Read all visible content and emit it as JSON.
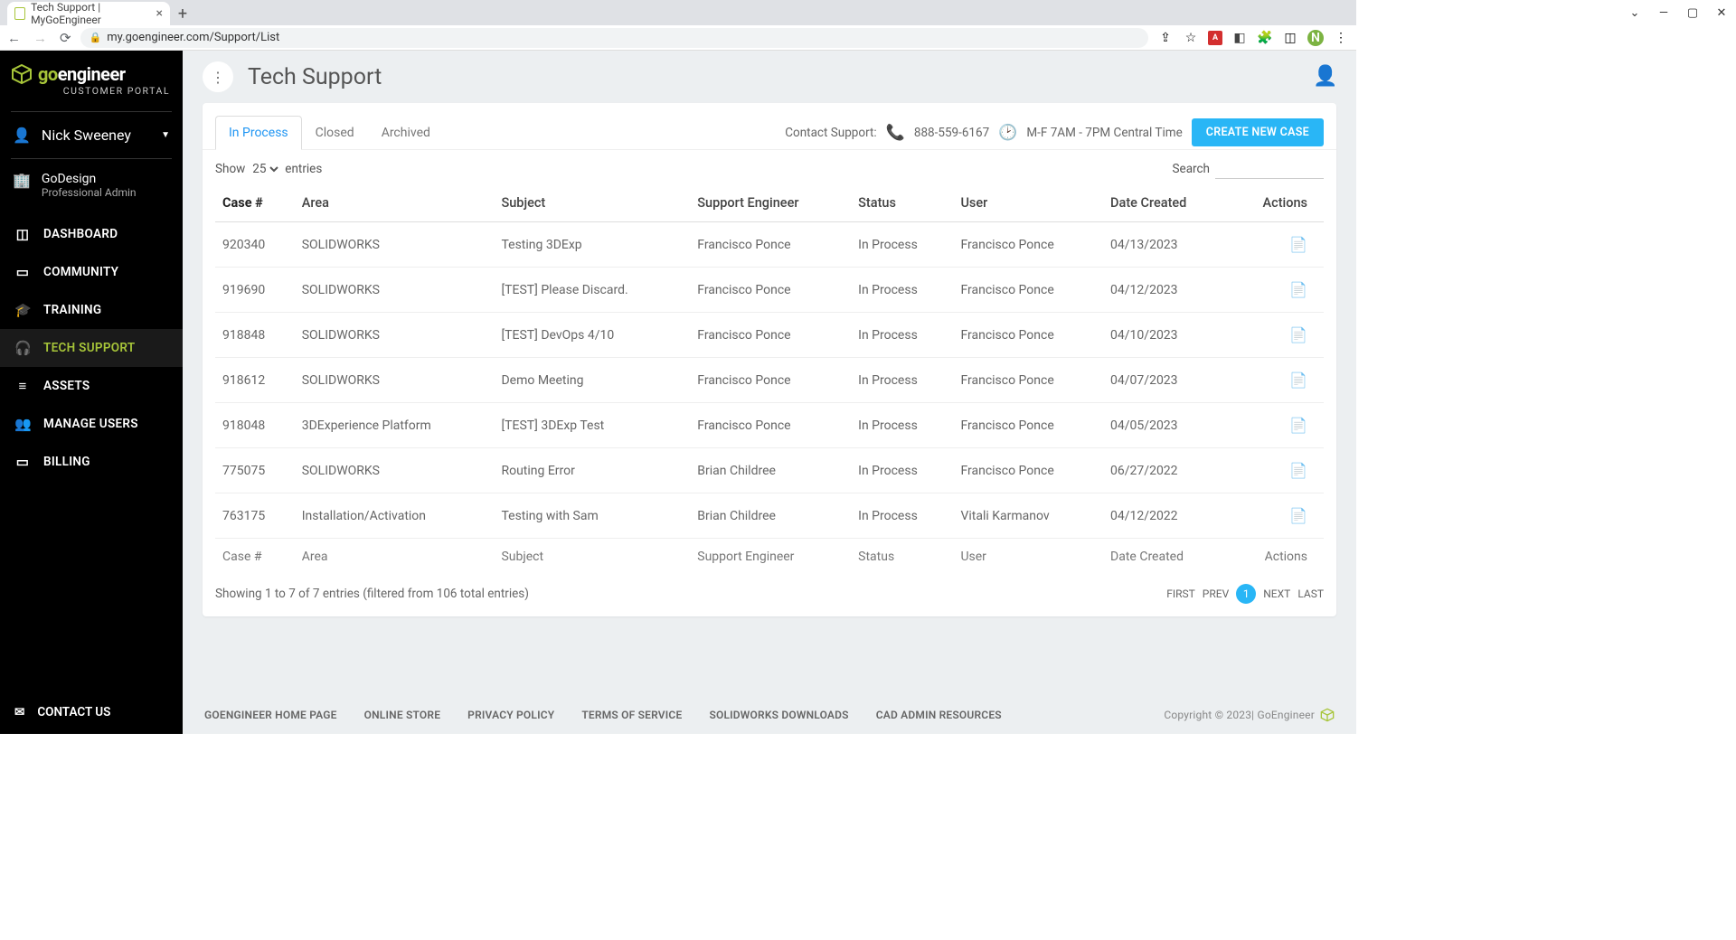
{
  "browser": {
    "tab_title": "Tech Support | MyGoEngineer",
    "url": "my.goengineer.com/Support/List",
    "avatar_letter": "N"
  },
  "sidebar": {
    "logo_go": "go",
    "logo_rest": "engineer",
    "portal": "CUSTOMER PORTAL",
    "user_name": "Nick Sweeney",
    "org_name": "GoDesign",
    "org_role": "Professional Admin",
    "items": [
      {
        "label": "DASHBOARD",
        "icon": "◫"
      },
      {
        "label": "COMMUNITY",
        "icon": "▭"
      },
      {
        "label": "TRAINING",
        "icon": "🎓"
      },
      {
        "label": "TECH SUPPORT",
        "icon": "🎧",
        "active": true
      },
      {
        "label": "ASSETS",
        "icon": "≡"
      },
      {
        "label": "MANAGE USERS",
        "icon": "👥"
      },
      {
        "label": "BILLING",
        "icon": "▭"
      }
    ],
    "contact": "CONTACT US"
  },
  "page": {
    "title": "Tech Support",
    "tabs": [
      "In Process",
      "Closed",
      "Archived"
    ],
    "active_tab": 0,
    "contact_label": "Contact Support:",
    "phone": "888-559-6167",
    "hours": "M-F 7AM - 7PM Central Time",
    "create_btn": "CREATE NEW CASE",
    "show_label": "Show",
    "entries_count": "25",
    "entries_label": "entries",
    "search_label": "Search",
    "columns": [
      "Case #",
      "Area",
      "Subject",
      "Support Engineer",
      "Status",
      "User",
      "Date Created",
      "Actions"
    ],
    "rows": [
      {
        "case": "920340",
        "area": "SOLIDWORKS",
        "subject": "Testing 3DExp",
        "engineer": "Francisco Ponce",
        "status": "In Process",
        "user": "Francisco Ponce",
        "date": "04/13/2023"
      },
      {
        "case": "919690",
        "area": "SOLIDWORKS",
        "subject": "[TEST] Please Discard.",
        "engineer": "Francisco Ponce",
        "status": "In Process",
        "user": "Francisco Ponce",
        "date": "04/12/2023"
      },
      {
        "case": "918848",
        "area": "SOLIDWORKS",
        "subject": "[TEST] DevOps 4/10",
        "engineer": "Francisco Ponce",
        "status": "In Process",
        "user": "Francisco Ponce",
        "date": "04/10/2023"
      },
      {
        "case": "918612",
        "area": "SOLIDWORKS",
        "subject": "Demo Meeting",
        "engineer": "Francisco Ponce",
        "status": "In Process",
        "user": "Francisco Ponce",
        "date": "04/07/2023"
      },
      {
        "case": "918048",
        "area": "3DExperience Platform",
        "subject": "[TEST] 3DExp Test",
        "engineer": "Francisco Ponce",
        "status": "In Process",
        "user": "Francisco Ponce",
        "date": "04/05/2023"
      },
      {
        "case": "775075",
        "area": "SOLIDWORKS",
        "subject": "Routing Error",
        "engineer": "Brian Childree",
        "status": "In Process",
        "user": "Francisco Ponce",
        "date": "06/27/2022"
      },
      {
        "case": "763175",
        "area": "Installation/Activation",
        "subject": "Testing with Sam",
        "engineer": "Brian Childree",
        "status": "In Process",
        "user": "Vitali Karmanov",
        "date": "04/12/2022"
      }
    ],
    "footer_cols": [
      "Case #",
      "Area",
      "Subject",
      "Support Engineer",
      "Status",
      "User",
      "Date Created",
      "Actions"
    ],
    "showing": "Showing 1 to 7 of 7 entries (filtered from 106 total entries)",
    "pager": {
      "first": "FIRST",
      "prev": "PREV",
      "page": "1",
      "next": "NEXT",
      "last": "LAST"
    }
  },
  "footer_links": [
    "GOENGINEER HOME PAGE",
    "ONLINE STORE",
    "PRIVACY POLICY",
    "TERMS OF SERVICE",
    "SOLIDWORKS DOWNLOADS",
    "CAD ADMIN RESOURCES"
  ],
  "copyright": "Copyright © 2023| GoEngineer"
}
